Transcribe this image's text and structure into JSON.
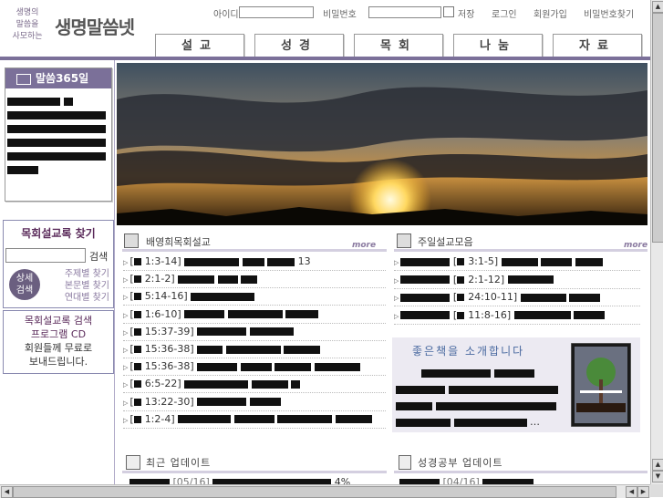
{
  "header": {
    "logo_small_lines": [
      "생명의",
      "말씀을",
      "사모하는"
    ],
    "logo_title": "생명말씀넷",
    "id_label": "아이디",
    "pw_label": "비밀번호",
    "save_label": "저장",
    "login_link": "로그인",
    "join_link": "회원가입",
    "find_pw_link": "비밀번호찾기"
  },
  "nav": [
    {
      "label": "설교"
    },
    {
      "label": "성경"
    },
    {
      "label": "목회"
    },
    {
      "label": "나눔"
    },
    {
      "label": "자료"
    }
  ],
  "sidebar": {
    "daily_title": "말씀365일",
    "search_title": "목회설교록 찾기",
    "search_button": "검색",
    "detail_button": "상세\n검색",
    "detail_line1": "상세",
    "detail_line2": "검색",
    "find_links": [
      "주제별 찾기",
      "본문별 찾기",
      "연대별 찾기"
    ],
    "cd_line1": "목회설교록 검색",
    "cd_line2": "프로그램 CD",
    "cd_line3": "회원들께 무료로",
    "cd_line4": "보내드립니다."
  },
  "sections": {
    "left_title": "배영희목회설교",
    "right_title": "주일설교모음",
    "more": "more",
    "recent_title": "최근 업데이트",
    "bible_title": "성경공부 업데이트",
    "book_title": "좋은책을 소개합니다"
  },
  "left_list": [
    "1:3-14]",
    "2:1-2]",
    "5:14-16]",
    "1:6-10]",
    "15:37-39]",
    "15:36-38]",
    "15:36-38]",
    "6:5-22]",
    "13:22-30]",
    "1:2-4]"
  ],
  "left_list_suffix": {
    "first": "13"
  },
  "right_list": [
    "3:1-5]",
    "2:1-12]",
    "24:10-11]",
    "11:8-16]"
  ],
  "recent": {
    "date": "[05/16]",
    "pct": "4%"
  },
  "bible": {
    "date": "[04/16]"
  }
}
